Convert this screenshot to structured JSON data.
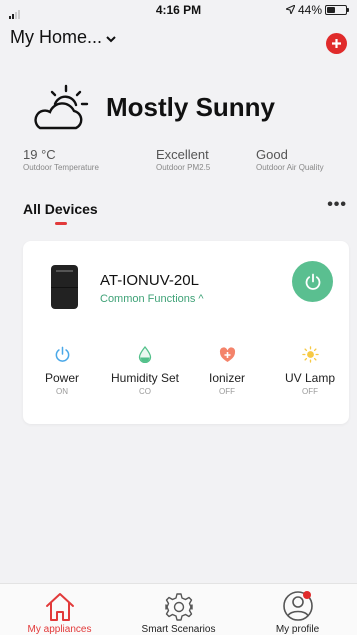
{
  "status_bar": {
    "time": "4:16 PM",
    "battery": "44%",
    "battery_level": 0.44
  },
  "header": {
    "home_name": "My Home...",
    "add_icon": "plus-icon"
  },
  "weather": {
    "condition": "Mostly Sunny",
    "icon": "partly-sunny-icon",
    "stats": [
      {
        "value": "19 °C",
        "label": "Outdoor Temperature"
      },
      {
        "value": "Excellent",
        "label": "Outdoor PM2.5"
      },
      {
        "value": "Good",
        "label": "Outdoor Air Quality"
      }
    ]
  },
  "devices_section": {
    "title": "All Devices",
    "more": "•••"
  },
  "device": {
    "name": "AT-IONUV-20L",
    "common_functions": "Common Functions ^",
    "functions": [
      {
        "name": "Power",
        "state": "ON",
        "icon": "power-icon",
        "color": "#4aa8e8"
      },
      {
        "name": "Humidity Set",
        "state": "CO",
        "icon": "water-drop-icon",
        "color": "#52c08a"
      },
      {
        "name": "Ionizer",
        "state": "OFF",
        "icon": "ionizer-icon",
        "color": "#f4836a"
      },
      {
        "name": "UV Lamp",
        "state": "OFF",
        "icon": "sun-icon",
        "color": "#f6c945"
      }
    ]
  },
  "tabs": [
    {
      "label": "My appliances",
      "icon": "home-icon",
      "active": true
    },
    {
      "label": "Smart Scenarios",
      "icon": "gear-icon",
      "active": false
    },
    {
      "label": "My profile",
      "icon": "profile-icon",
      "active": false
    }
  ],
  "colors": {
    "accent_red": "#e02b2b",
    "power_green": "#5abf90",
    "link_green": "#3fa277"
  }
}
